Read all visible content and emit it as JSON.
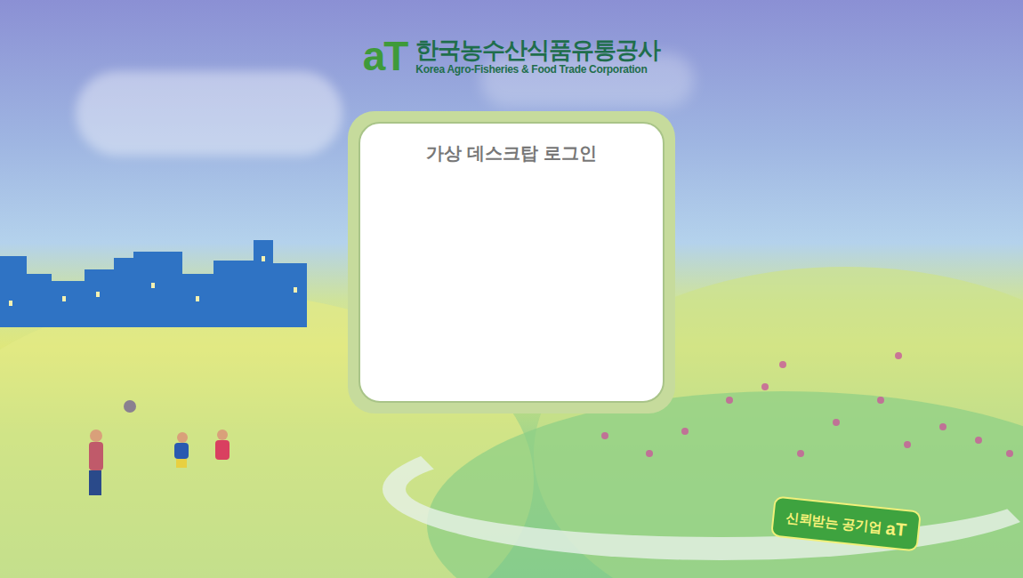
{
  "header": {
    "logo_mark": "aT",
    "name": "한국농수산식품유통공사",
    "english_name": "Korea Agro-Fisheries & Food Trade Corporation"
  },
  "login": {
    "title": "가상 데스크탑 로그인"
  },
  "badge": {
    "text": "신뢰받는 공기업",
    "mark": "aT"
  }
}
